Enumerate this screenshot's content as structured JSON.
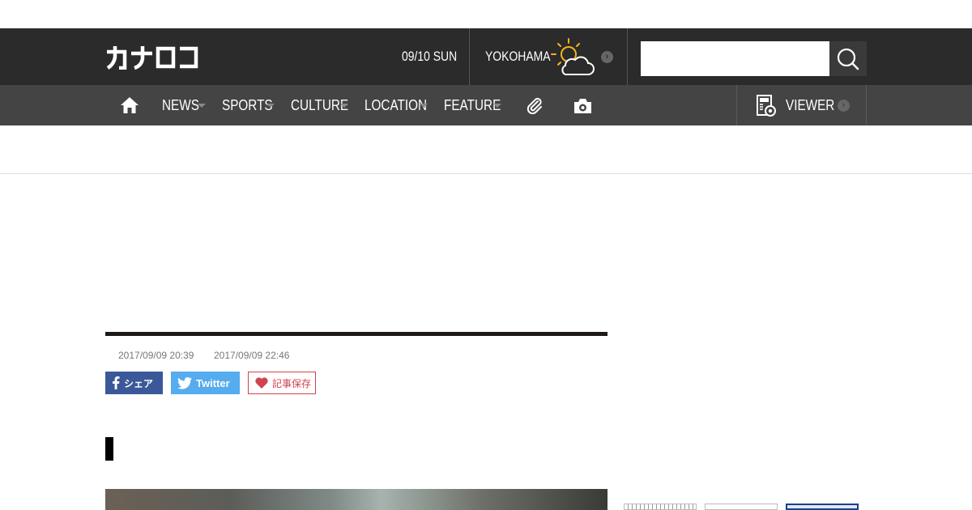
{
  "header": {
    "logo_text": "カナロコ",
    "date": "09/10 SUN",
    "city": "YOKOHAMA",
    "weather_icon": "partly-cloudy-icon",
    "search_placeholder": ""
  },
  "nav": {
    "items": [
      {
        "label": "NEWS",
        "has_dropdown": true
      },
      {
        "label": "SPORTS",
        "has_dropdown": true
      },
      {
        "label": "CULTURE",
        "has_dropdown": true
      },
      {
        "label": "LOCATION",
        "has_dropdown": true
      },
      {
        "label": "FEATURE",
        "has_dropdown": true
      }
    ],
    "viewer_label": "VIEWER"
  },
  "article": {
    "published": "2017/09/09 20:39",
    "updated": "2017/09/09 22:46",
    "share": {
      "facebook_label": "シェア",
      "twitter_label": "Twitter",
      "save_label": "記事保存"
    }
  },
  "colors": {
    "header_bg": "#2b2b2b",
    "nav_bg": "#444444",
    "facebook": "#3b5998",
    "twitter": "#55acee",
    "save": "#d0444e",
    "weather_sun": "#f5b21b"
  }
}
